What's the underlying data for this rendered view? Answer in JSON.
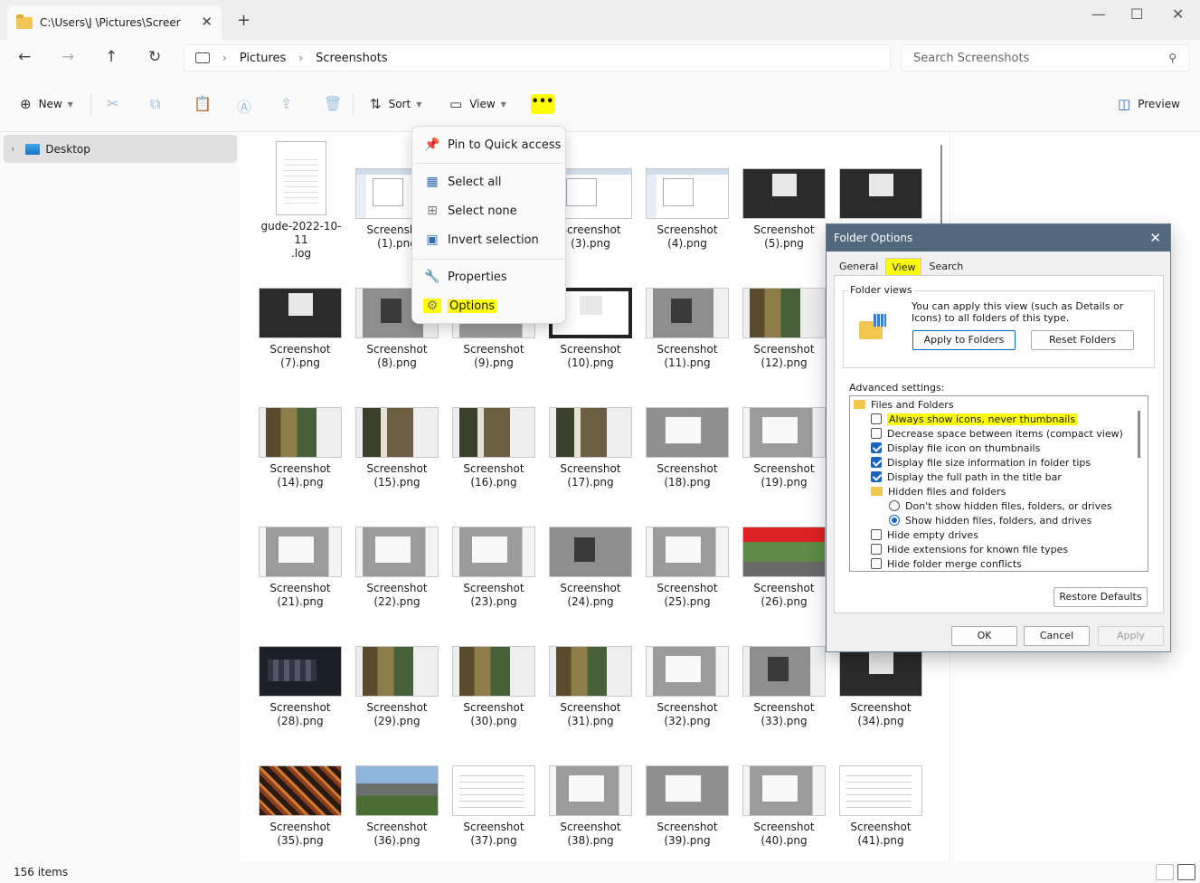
{
  "window": {
    "tab_title": "C:\\Users\\J      \\Pictures\\Screer",
    "tab_close": "✕",
    "new_tab": "+",
    "min": "—",
    "max": "☐",
    "close": "✕"
  },
  "nav": {
    "back": "←",
    "forward": "→",
    "up": "↑",
    "refresh": "↻"
  },
  "breadcrumb": [
    "Pictures",
    "Screenshots"
  ],
  "breadcrumb_sep": "›",
  "search": {
    "placeholder": "Search Screenshots"
  },
  "toolbar": {
    "new_label": "New",
    "sort_label": "Sort",
    "view_label": "View",
    "more_label": "•••",
    "preview_label": "Preview"
  },
  "sidebar": {
    "items": [
      {
        "label": "Desktop"
      }
    ]
  },
  "files": [
    {
      "line1": "gude-2022-10-11",
      "line2": ".log"
    },
    {
      "line1": "Screenshot",
      "line2": "(1).png"
    },
    {
      "line1": "Screenshot",
      "line2": "(3).png"
    },
    {
      "line1": "Screenshot",
      "line2": "(4).png"
    },
    {
      "line1": "Screenshot",
      "line2": "(5).png"
    },
    {
      "line1": "Screenshot",
      "line2": "(7).png"
    },
    {
      "line1": "Screenshot",
      "line2": "(8).png"
    },
    {
      "line1": "Screenshot",
      "line2": "(9).png"
    },
    {
      "line1": "Screenshot",
      "line2": "(10).png"
    },
    {
      "line1": "Screenshot",
      "line2": "(11).png"
    },
    {
      "line1": "Screenshot",
      "line2": "(12).png"
    },
    {
      "line1": "Screenshot",
      "line2": "(14).png"
    },
    {
      "line1": "Screenshot",
      "line2": "(15).png"
    },
    {
      "line1": "Screenshot",
      "line2": "(16).png"
    },
    {
      "line1": "Screenshot",
      "line2": "(17).png"
    },
    {
      "line1": "Screenshot",
      "line2": "(18).png"
    },
    {
      "line1": "Screenshot",
      "line2": "(19).png"
    },
    {
      "line1": "Screenshot",
      "line2": "(21).png"
    },
    {
      "line1": "Screenshot",
      "line2": "(22).png"
    },
    {
      "line1": "Screenshot",
      "line2": "(23).png"
    },
    {
      "line1": "Screenshot",
      "line2": "(24).png"
    },
    {
      "line1": "Screenshot",
      "line2": "(25).png"
    },
    {
      "line1": "Screenshot",
      "line2": "(26).png"
    },
    {
      "line1": "Screenshot",
      "line2": "(28).png"
    },
    {
      "line1": "Screenshot",
      "line2": "(29).png"
    },
    {
      "line1": "Screenshot",
      "line2": "(30).png"
    },
    {
      "line1": "Screenshot",
      "line2": "(31).png"
    },
    {
      "line1": "Screenshot",
      "line2": "(32).png"
    },
    {
      "line1": "Screenshot",
      "line2": "(33).png"
    },
    {
      "line1": "Screenshot",
      "line2": "(34).png"
    },
    {
      "line1": "Screenshot",
      "line2": "(35).png"
    },
    {
      "line1": "Screenshot",
      "line2": "(36).png"
    },
    {
      "line1": "Screenshot",
      "line2": "(37).png"
    },
    {
      "line1": "Screenshot",
      "line2": "(38).png"
    },
    {
      "line1": "Screenshot",
      "line2": "(39).png"
    },
    {
      "line1": "Screenshot",
      "line2": "(40).png"
    },
    {
      "line1": "Screenshot",
      "line2": "(41).png"
    }
  ],
  "status": {
    "item_count": "156 items"
  },
  "context_menu": {
    "pin": "Pin to Quick access",
    "select_all": "Select all",
    "select_none": "Select none",
    "invert": "Invert selection",
    "properties": "Properties",
    "options": "Options"
  },
  "dialog": {
    "title": "Folder Options",
    "close": "✕",
    "tabs": [
      "General",
      "View",
      "Search"
    ],
    "folder_views_title": "Folder views",
    "folder_views_text": "You can apply this view (such as Details or Icons) to all folders of this type.",
    "apply_folders": "Apply to Folders",
    "reset_folders": "Reset Folders",
    "advanced_label": "Advanced settings:",
    "settings": [
      {
        "label": "Files and Folders",
        "type": "folder"
      },
      {
        "label": "Always show icons, never thumbnails",
        "type": "checkbox",
        "checked": false
      },
      {
        "label": "Decrease space between items (compact view)",
        "type": "checkbox",
        "checked": false
      },
      {
        "label": "Display file icon on thumbnails",
        "type": "checkbox",
        "checked": true
      },
      {
        "label": "Display file size information in folder tips",
        "type": "checkbox",
        "checked": true
      },
      {
        "label": "Display the full path in the title bar",
        "type": "checkbox",
        "checked": true
      },
      {
        "label": "Hidden files and folders",
        "type": "folder"
      },
      {
        "label": "Don't show hidden files, folders, or drives",
        "type": "radio",
        "checked": false
      },
      {
        "label": "Show hidden files, folders, and drives",
        "type": "radio",
        "checked": true
      },
      {
        "label": "Hide empty drives",
        "type": "checkbox",
        "checked": false
      },
      {
        "label": "Hide extensions for known file types",
        "type": "checkbox",
        "checked": false
      },
      {
        "label": "Hide folder merge conflicts",
        "type": "checkbox",
        "checked": false
      }
    ],
    "restore_defaults": "Restore Defaults",
    "ok": "OK",
    "cancel": "Cancel",
    "apply": "Apply"
  },
  "colors": {
    "highlight": "#ffff00",
    "accent": "#1565c0",
    "dialog_title": "#52687d"
  }
}
